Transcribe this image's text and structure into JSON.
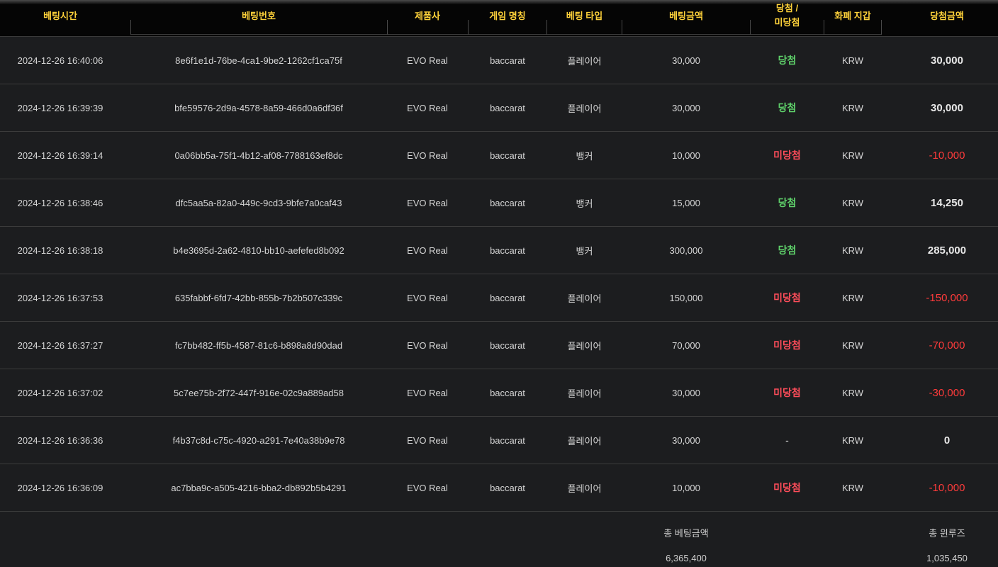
{
  "columns": {
    "time": "베팅시간",
    "id": "베팅번호",
    "provider": "제품사",
    "game": "게임 명칭",
    "type": "베팅 타입",
    "amount": "베팅금액",
    "result_line1": "당첨 /",
    "result_line2": "미당첨",
    "currency": "화폐 지갑",
    "win_amount": "당첨금액"
  },
  "colors": {
    "header_text": "#ffd23a",
    "win": "#5fd36b",
    "lose": "#ff4d5a",
    "negative": "#ff3b3b"
  },
  "rows": [
    {
      "time": "2024-12-26 16:40:06",
      "id": "8e6f1e1d-76be-4ca1-9be2-1262cf1ca75f",
      "provider": "EVO Real",
      "game": "baccarat",
      "type": "플레이어",
      "amount": "30,000",
      "result": "당첨",
      "result_class": "win",
      "currency": "KRW",
      "win_amount": "30,000",
      "win_class": "pos"
    },
    {
      "time": "2024-12-26 16:39:39",
      "id": "bfe59576-2d9a-4578-8a59-466d0a6df36f",
      "provider": "EVO Real",
      "game": "baccarat",
      "type": "플레이어",
      "amount": "30,000",
      "result": "당첨",
      "result_class": "win",
      "currency": "KRW",
      "win_amount": "30,000",
      "win_class": "pos"
    },
    {
      "time": "2024-12-26 16:39:14",
      "id": "0a06bb5a-75f1-4b12-af08-7788163ef8dc",
      "provider": "EVO Real",
      "game": "baccarat",
      "type": "뱅커",
      "amount": "10,000",
      "result": "미당첨",
      "result_class": "lose",
      "currency": "KRW",
      "win_amount": "-10,000",
      "win_class": "neg"
    },
    {
      "time": "2024-12-26 16:38:46",
      "id": "dfc5aa5a-82a0-449c-9cd3-9bfe7a0caf43",
      "provider": "EVO Real",
      "game": "baccarat",
      "type": "뱅커",
      "amount": "15,000",
      "result": "당첨",
      "result_class": "win",
      "currency": "KRW",
      "win_amount": "14,250",
      "win_class": "pos"
    },
    {
      "time": "2024-12-26 16:38:18",
      "id": "b4e3695d-2a62-4810-bb10-aefefed8b092",
      "provider": "EVO Real",
      "game": "baccarat",
      "type": "뱅커",
      "amount": "300,000",
      "result": "당첨",
      "result_class": "win",
      "currency": "KRW",
      "win_amount": "285,000",
      "win_class": "pos"
    },
    {
      "time": "2024-12-26 16:37:53",
      "id": "635fabbf-6fd7-42bb-855b-7b2b507c339c",
      "provider": "EVO Real",
      "game": "baccarat",
      "type": "플레이어",
      "amount": "150,000",
      "result": "미당첨",
      "result_class": "lose",
      "currency": "KRW",
      "win_amount": "-150,000",
      "win_class": "neg"
    },
    {
      "time": "2024-12-26 16:37:27",
      "id": "fc7bb482-ff5b-4587-81c6-b898a8d90dad",
      "provider": "EVO Real",
      "game": "baccarat",
      "type": "플레이어",
      "amount": "70,000",
      "result": "미당첨",
      "result_class": "lose",
      "currency": "KRW",
      "win_amount": "-70,000",
      "win_class": "neg"
    },
    {
      "time": "2024-12-26 16:37:02",
      "id": "5c7ee75b-2f72-447f-916e-02c9a889ad58",
      "provider": "EVO Real",
      "game": "baccarat",
      "type": "플레이어",
      "amount": "30,000",
      "result": "미당첨",
      "result_class": "lose",
      "currency": "KRW",
      "win_amount": "-30,000",
      "win_class": "neg"
    },
    {
      "time": "2024-12-26 16:36:36",
      "id": "f4b37c8d-c75c-4920-a291-7e40a38b9e78",
      "provider": "EVO Real",
      "game": "baccarat",
      "type": "플레이어",
      "amount": "30,000",
      "result": "-",
      "result_class": "none",
      "currency": "KRW",
      "win_amount": "0",
      "win_class": "pos"
    },
    {
      "time": "2024-12-26 16:36:09",
      "id": "ac7bba9c-a505-4216-bba2-db892b5b4291",
      "provider": "EVO Real",
      "game": "baccarat",
      "type": "플레이어",
      "amount": "10,000",
      "result": "미당첨",
      "result_class": "lose",
      "currency": "KRW",
      "win_amount": "-10,000",
      "win_class": "neg"
    }
  ],
  "footer": {
    "total_bet_label": "총 베팅금액",
    "total_bet_value": "6,365,400",
    "total_winloss_label": "총 윈루즈",
    "total_winloss_value": "1,035,450"
  }
}
